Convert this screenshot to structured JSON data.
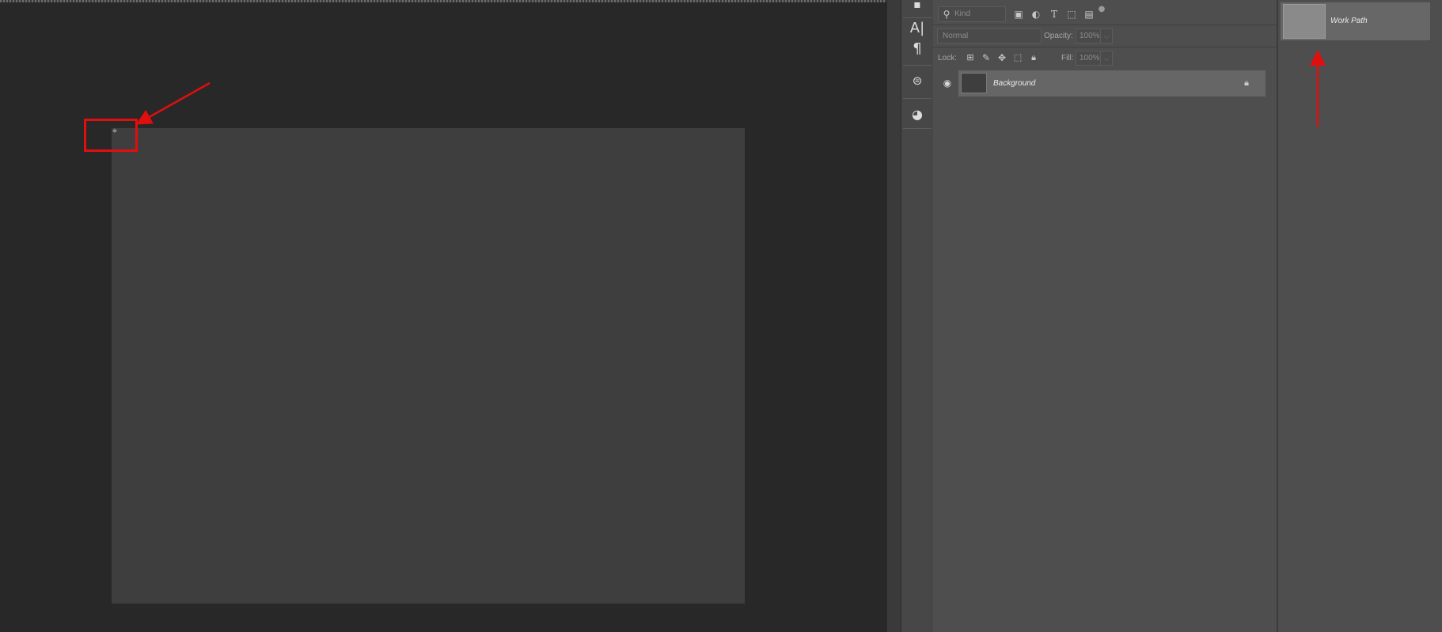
{
  "layers_panel": {
    "filter": {
      "kind_label": "Kind"
    },
    "blend_mode": {
      "value": "Normal"
    },
    "opacity": {
      "label": "Opacity:",
      "value": "100%"
    },
    "lock": {
      "label": "Lock:"
    },
    "fill": {
      "label": "Fill:",
      "value": "100%"
    },
    "layers": [
      {
        "name": "Background",
        "visible": true,
        "locked": true
      }
    ]
  },
  "paths_panel": {
    "paths": [
      {
        "name": "Work Path"
      }
    ]
  },
  "icons": {
    "search": "search-icon",
    "filter_pixel": "image-filter-icon",
    "filter_adjust": "adjustment-filter-icon",
    "filter_type": "type-filter-icon",
    "filter_shape": "shape-filter-icon",
    "filter_smart": "smart-object-filter-icon",
    "eye": "eye-icon",
    "lock": "lock-icon"
  },
  "colors": {
    "annotation_red": "#e10e0e"
  }
}
